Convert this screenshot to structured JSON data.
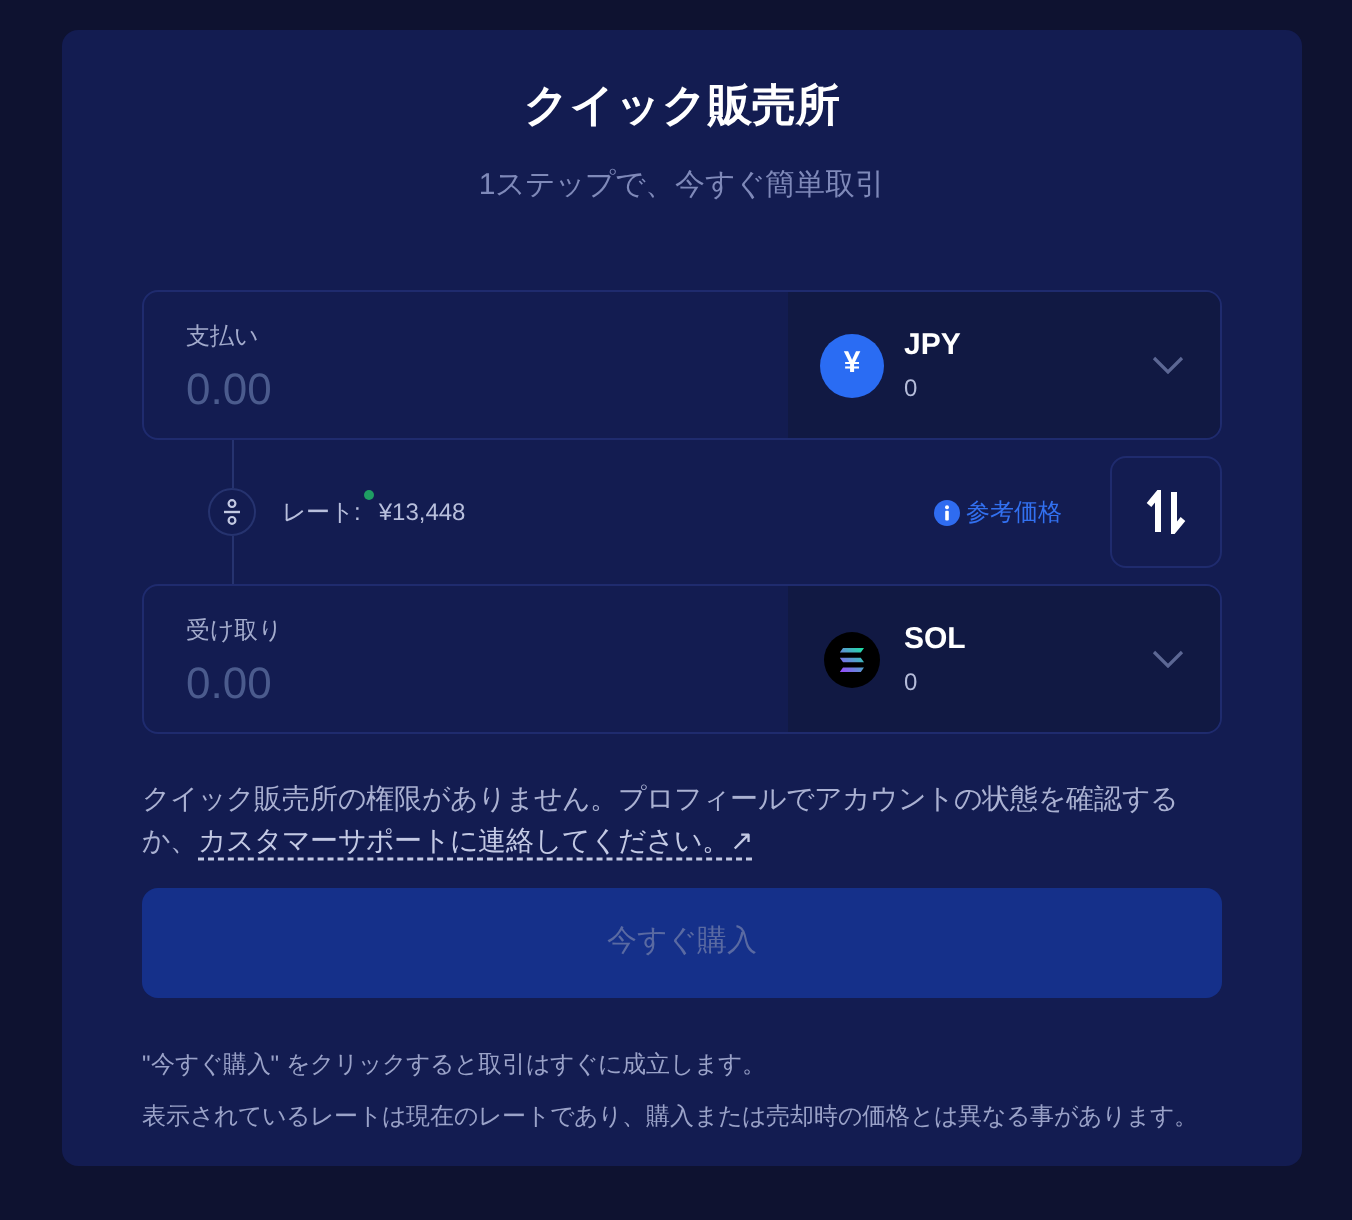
{
  "header": {
    "title": "クイック販売所",
    "subtitle": "1ステップで、今すぐ簡単取引"
  },
  "pay": {
    "label": "支払い",
    "placeholder": "0.00",
    "currency": {
      "kind": "yen",
      "symbol": "¥",
      "code": "JPY",
      "balance": "0"
    }
  },
  "rate": {
    "label": "レート:",
    "live": true,
    "value": "¥13,448",
    "reference_link": "参考価格"
  },
  "receive": {
    "label": "受け取り",
    "placeholder": "0.00",
    "currency": {
      "kind": "sol",
      "code": "SOL",
      "balance": "0"
    }
  },
  "notice": {
    "text": "クイック販売所の権限がありません。プロフィールでアカウントの状態を確認するか、",
    "link": "カスタマーサポートに連絡してください。↗"
  },
  "buy_button": {
    "label": "今すぐ購入",
    "disabled": true
  },
  "footnotes": [
    "\"今すぐ購入\" をクリックすると取引はすぐに成立します。",
    "表示されているレートは現在のレートであり、購入または売却時の価格とは異なる事があります。"
  ]
}
